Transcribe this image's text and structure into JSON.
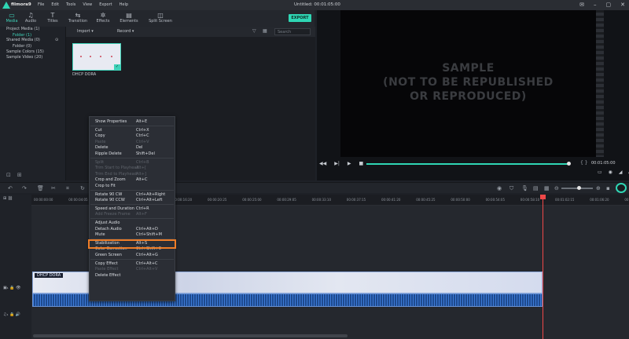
{
  "app": {
    "logo_text": "filmora9",
    "window_title": "Untitled: 00:01:05:00"
  },
  "menu": [
    "File",
    "Edit",
    "Tools",
    "View",
    "Export",
    "Help"
  ],
  "toolbar": [
    {
      "label": "Media",
      "icon": "folder-icon",
      "active": true
    },
    {
      "label": "Audio",
      "icon": "music-note-icon"
    },
    {
      "label": "Titles",
      "icon": "text-icon"
    },
    {
      "label": "Transition",
      "icon": "transition-icon"
    },
    {
      "label": "Effects",
      "icon": "effects-icon"
    },
    {
      "label": "Elements",
      "icon": "elements-icon"
    },
    {
      "label": "Split Screen",
      "icon": "split-screen-icon"
    }
  ],
  "export_label": "EXPORT",
  "sidebar": {
    "items": [
      {
        "label": "Project Media (1)",
        "count": ""
      },
      {
        "label": "Folder (1)",
        "count": "",
        "selected": true
      },
      {
        "label": "Shared Media (0)",
        "count": "⊙"
      },
      {
        "label": "Folder (0)",
        "count": ""
      },
      {
        "label": "Sample Colors (15)",
        "count": ""
      },
      {
        "label": "Sample Video (20)",
        "count": ""
      }
    ]
  },
  "media": {
    "import_label": "Import",
    "record_label": "Record",
    "search_placeholder": "Search",
    "thumb_label": "DHCP DORA"
  },
  "preview": {
    "watermark": [
      "SAMPLE",
      "(NOT TO BE REPUBLISHED",
      "OR REPRODUCED)"
    ],
    "timecode": "00:01:05:00",
    "progress": 0.995
  },
  "ruler_ticks": [
    "00:00:00:00",
    "00:00:04:05",
    "00:00:08:10",
    "00:00:12:15",
    "00:00:16:20",
    "00:00:20:25",
    "00:00:25:00",
    "00:00:29:05",
    "00:00:33:10",
    "00:00:37:15",
    "00:00:41:20",
    "00:00:45:25",
    "00:00:50:00",
    "00:00:54:05",
    "00:00:58:10",
    "00:01:02:15",
    "00:01:06:20",
    "00:01:10:25"
  ],
  "clip_label": "DHCP DORA",
  "context_menu": [
    {
      "label": "Show Properties",
      "shortcut": "Alt+E",
      "enabled": true
    },
    {
      "sep": true
    },
    {
      "label": "Cut",
      "shortcut": "Ctrl+X",
      "enabled": true
    },
    {
      "label": "Copy",
      "shortcut": "Ctrl+C",
      "enabled": true
    },
    {
      "label": "Paste",
      "shortcut": "Ctrl+V",
      "enabled": false
    },
    {
      "label": "Delete",
      "shortcut": "Del",
      "enabled": true
    },
    {
      "label": "Ripple Delete",
      "shortcut": "Shift+Del",
      "enabled": true
    },
    {
      "sep": true
    },
    {
      "label": "Split",
      "shortcut": "Ctrl+B",
      "enabled": false
    },
    {
      "label": "Trim Start to Playhead",
      "shortcut": "Alt+[",
      "enabled": false
    },
    {
      "label": "Trim End to Playhead",
      "shortcut": "Alt+]",
      "enabled": false
    },
    {
      "label": "Crop and Zoom",
      "shortcut": "Alt+C",
      "enabled": true
    },
    {
      "label": "Crop to Fit",
      "shortcut": "",
      "enabled": true
    },
    {
      "sep": true
    },
    {
      "label": "Rotate 90 CW",
      "shortcut": "Ctrl+Alt+Right",
      "enabled": true
    },
    {
      "label": "Rotate 90 CCW",
      "shortcut": "Ctrl+Alt+Left",
      "enabled": true
    },
    {
      "sep": true
    },
    {
      "label": "Speed and Duration",
      "shortcut": "Ctrl+R",
      "enabled": true
    },
    {
      "label": "Add Freeze Frame",
      "shortcut": "Alt+F",
      "enabled": false
    },
    {
      "sep": true
    },
    {
      "label": "Adjust Audio",
      "shortcut": "",
      "enabled": true
    },
    {
      "label": "Detach Audio",
      "shortcut": "Ctrl+Alt+D",
      "enabled": true,
      "highlighted": true
    },
    {
      "label": "Mute",
      "shortcut": "Ctrl+Shift+M",
      "enabled": true
    },
    {
      "sep": true
    },
    {
      "label": "Stabilization",
      "shortcut": "Alt+S",
      "enabled": true
    },
    {
      "label": "Color Correction",
      "shortcut": "Ctrl+Shift+C",
      "enabled": true
    },
    {
      "label": "Green Screen",
      "shortcut": "Ctrl+Alt+G",
      "enabled": true
    },
    {
      "sep": true
    },
    {
      "label": "Copy Effect",
      "shortcut": "Ctrl+Alt+C",
      "enabled": true
    },
    {
      "label": "Paste Effect",
      "shortcut": "Ctrl+Alt+V",
      "enabled": false
    },
    {
      "label": "Delete Effect",
      "shortcut": "",
      "enabled": true
    }
  ],
  "colors": {
    "accent": "#2fd6b4",
    "playhead": "#f04848",
    "highlight": "#ef7d27"
  }
}
